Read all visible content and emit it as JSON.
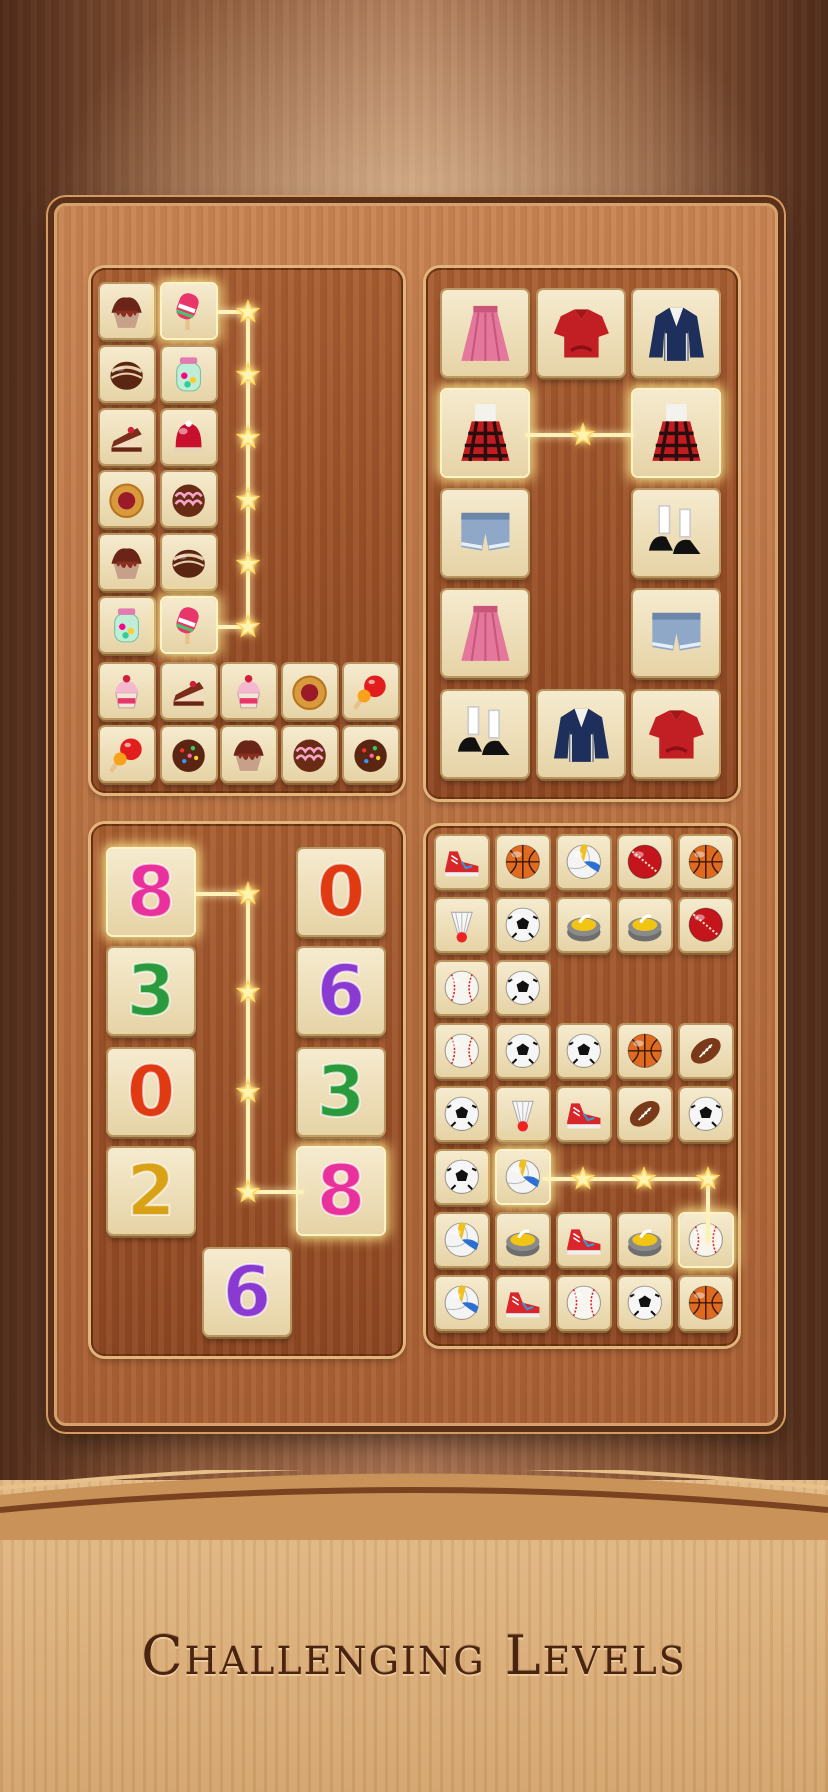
{
  "caption": "Challenging Levels",
  "panels": [
    {
      "id": "sweets",
      "name": "panel-sweets"
    },
    {
      "id": "clothes",
      "name": "panel-clothes"
    },
    {
      "id": "numbers",
      "name": "panel-numbers"
    },
    {
      "id": "sports",
      "name": "panel-sports"
    }
  ],
  "number_tiles": [
    "8",
    "0",
    "3",
    "6",
    "0",
    "3",
    "2",
    "8",
    "6"
  ],
  "icons": {
    "sweets": [
      "chocolate-cupcake-icon",
      "popsicle-icon",
      "truffle-icon",
      "candy-jar-icon",
      "cake-slice-icon",
      "jelly-dome-icon",
      "jam-cookie-icon",
      "frosted-donut-icon",
      "chocolate-cupcake-icon",
      "truffle-icon",
      "candy-jar-icon",
      "popsicle-icon",
      "sundae-cup-icon",
      "cake-slice-icon",
      "sundae-cup-icon",
      "jam-cookie-icon",
      "candy-apple-icon",
      "candy-apple-icon",
      "sprinkle-cookie-icon",
      "chocolate-cupcake-icon",
      "frosted-donut-icon",
      "sprinkle-cookie-icon"
    ],
    "clothes": [
      "pink-skirt-icon",
      "red-blouse-icon",
      "navy-jacket-icon",
      "plaid-dress-icon",
      "plaid-dress-icon",
      "denim-shorts-icon",
      "mary-jane-shoes-icon",
      "pink-skirt-icon",
      "denim-shorts-icon",
      "mary-jane-shoes-icon",
      "navy-jacket-icon",
      "red-blouse-icon"
    ],
    "sports": [
      "sneaker-icon",
      "basketball-icon",
      "volleyball-icon",
      "cricket-ball-icon",
      "basketball-icon",
      "shuttlecock-icon",
      "soccer-ball-icon",
      "curling-stone-icon",
      "curling-stone-icon",
      "cricket-ball-icon",
      "baseball-icon",
      "soccer-ball-icon",
      "baseball-icon",
      "soccer-ball-icon",
      "soccer-ball-icon",
      "basketball-icon",
      "football-icon",
      "soccer-ball-icon",
      "shuttlecock-icon",
      "sneaker-icon",
      "football-icon",
      "soccer-ball-icon",
      "soccer-ball-icon",
      "volleyball-icon",
      "volleyball-icon",
      "curling-stone-icon",
      "sneaker-icon",
      "curling-stone-icon",
      "baseball-icon",
      "volleyball-icon",
      "sneaker-icon",
      "baseball-icon",
      "soccer-ball-icon",
      "basketball-icon"
    ]
  },
  "colors": {
    "path_glow": "#ffe9a0",
    "digit_pink": "#e8319a",
    "digit_green": "#2a9a3c",
    "digit_red": "#e03a12",
    "digit_purple": "#8a3ad0",
    "digit_gold": "#d9a216"
  }
}
